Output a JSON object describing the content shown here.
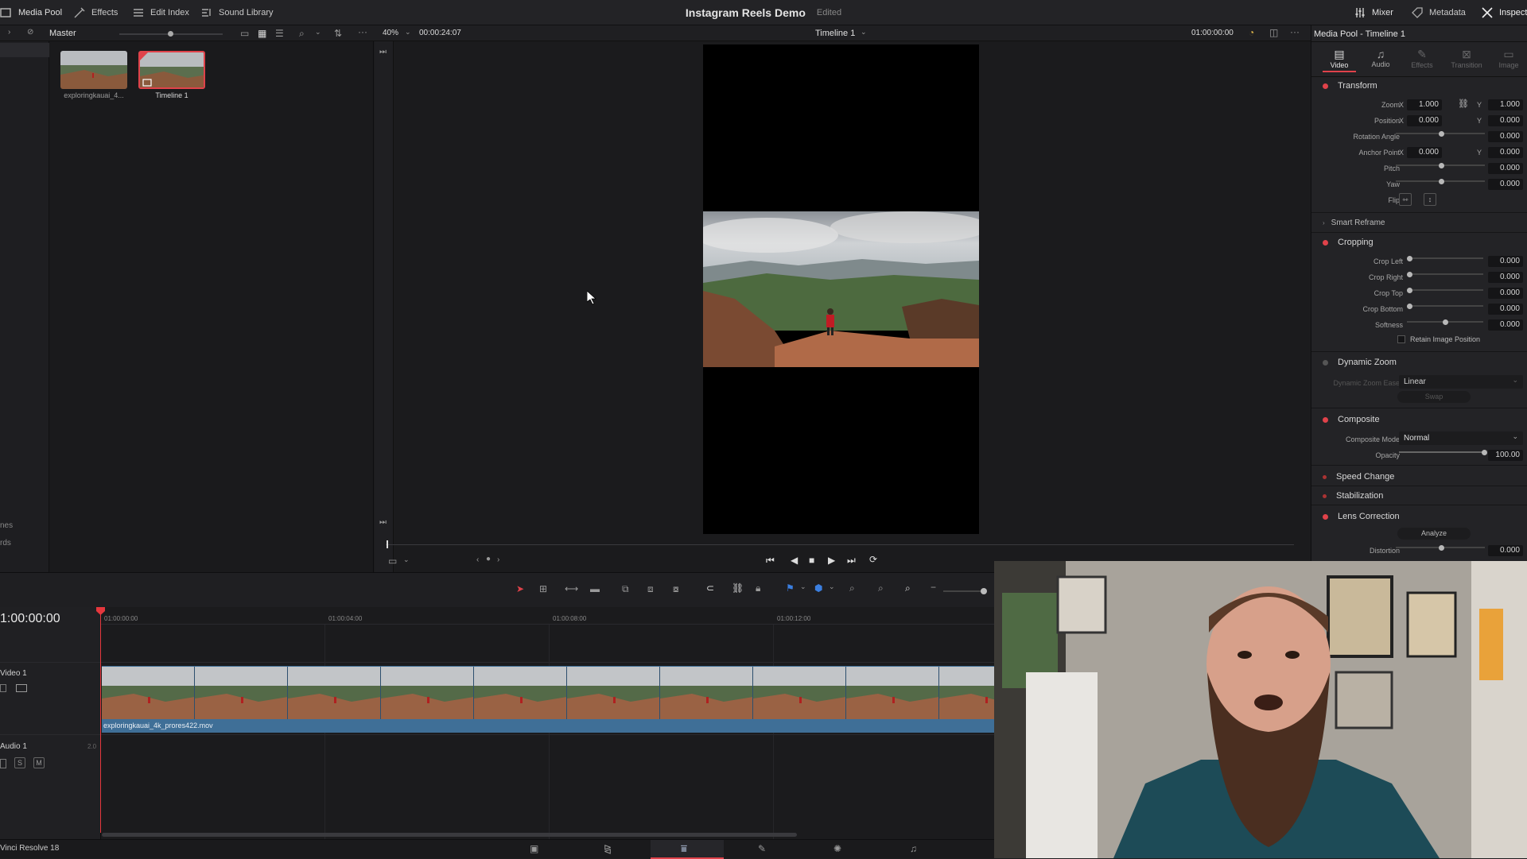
{
  "topbar": {
    "media_pool": "Media Pool",
    "effects": "Effects",
    "edit_index": "Edit Index",
    "sound_library": "Sound Library",
    "project_title": "Instagram Reels Demo",
    "project_status": "Edited",
    "mixer": "Mixer",
    "metadata": "Metadata",
    "inspector": "Inspecto"
  },
  "pool": {
    "bin_name": "Master",
    "clips": [
      {
        "label": "exploringkauai_4..."
      },
      {
        "label": "Timeline 1"
      }
    ],
    "side_items": [
      "nes",
      "rds"
    ]
  },
  "viewer": {
    "zoom": "40%",
    "duration": "00:00:24:07",
    "timeline_name": "Timeline 1",
    "timecode": "01:00:00:00"
  },
  "inspector": {
    "title": "Media Pool - Timeline 1",
    "tabs": [
      "Video",
      "Audio",
      "Effects",
      "Transition",
      "Image"
    ],
    "transform": {
      "header": "Transform",
      "zoom_label": "Zoom",
      "zoom_x": "1.000",
      "zoom_y": "1.000",
      "position_label": "Position",
      "position_x": "0.000",
      "position_y": "0.000",
      "rotation_label": "Rotation Angle",
      "rotation": "0.000",
      "anchor_label": "Anchor Point",
      "anchor_x": "0.000",
      "anchor_y": "0.000",
      "pitch_label": "Pitch",
      "pitch": "0.000",
      "yaw_label": "Yaw",
      "yaw": "0.000",
      "flip_label": "Flip",
      "x": "X",
      "y": "Y"
    },
    "smart_reframe": "Smart Reframe",
    "cropping": {
      "header": "Cropping",
      "left_label": "Crop Left",
      "left": "0.000",
      "right_label": "Crop Right",
      "right": "0.000",
      "top_label": "Crop Top",
      "top": "0.000",
      "bottom_label": "Crop Bottom",
      "bottom": "0.000",
      "softness_label": "Softness",
      "softness": "0.000",
      "retain": "Retain Image Position"
    },
    "dynamic_zoom": {
      "header": "Dynamic Zoom",
      "ease_label": "Dynamic Zoom Ease",
      "ease": "Linear",
      "swap": "Swap"
    },
    "composite": {
      "header": "Composite",
      "mode_label": "Composite Mode",
      "mode": "Normal",
      "opacity_label": "Opacity",
      "opacity": "100.00"
    },
    "speed_change": "Speed Change",
    "stabilization": "Stabilization",
    "lens": {
      "header": "Lens Correction",
      "analyze": "Analyze",
      "distortion_label": "Distortion",
      "distortion": "0.000"
    }
  },
  "timeline": {
    "timecode": "1:00:00:00",
    "ruler": [
      "01:00:00:00",
      "01:00:04:00",
      "01:00:08:00",
      "01:00:12:00"
    ],
    "video_track": "Video 1",
    "audio_track": "Audio 1",
    "audio_channels": "2.0",
    "solo": "S",
    "mute": "M",
    "clip_name": "exploringkauai_4k_prores422.mov"
  },
  "status": {
    "app_name": "Vinci Resolve 18"
  },
  "colors": {
    "accent_red": "#e0424a",
    "clip_blue": "#3f6f97",
    "playhead": "#e5373d"
  }
}
